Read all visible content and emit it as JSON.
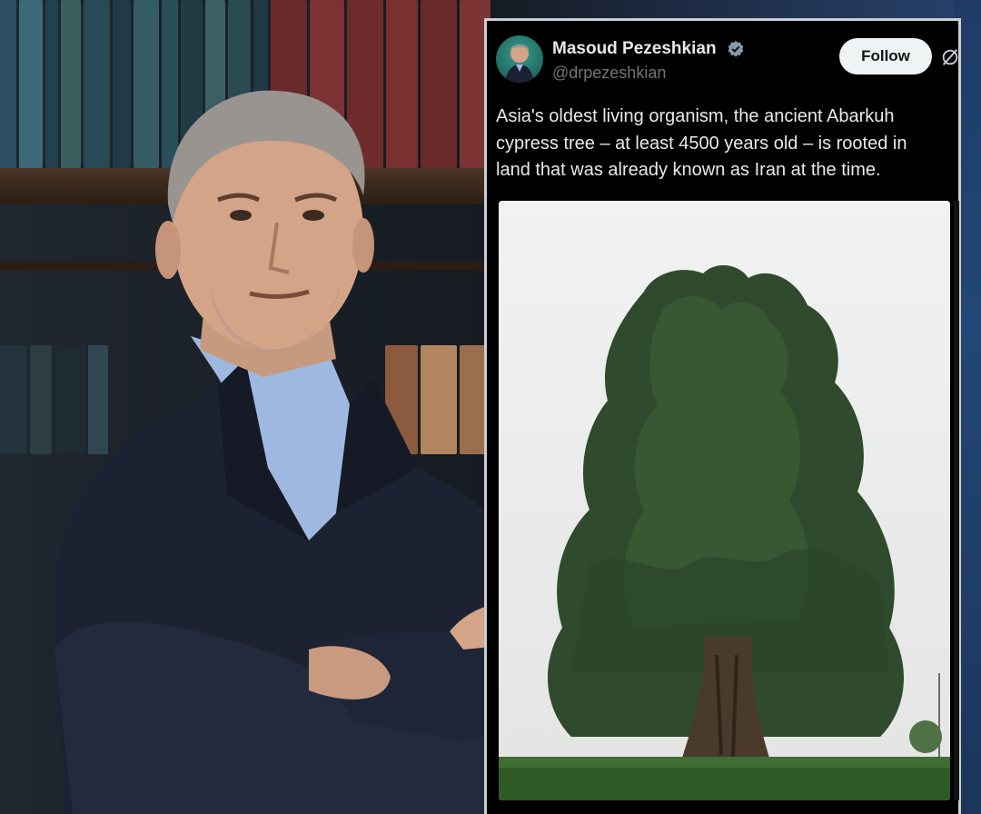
{
  "tweet": {
    "author_name": "Masoud Pezeshkian",
    "handle": "@drpezeshkian",
    "follow_label": "Follow",
    "text_lines": [
      "Asia's oldest living organism, the ancient Abarkuh",
      "cypress tree – at least 4500 years old – is rooted in",
      "land that was already known as Iran at the time."
    ],
    "verified_icon": "verified-badge-icon",
    "more_icon": "grok-icon"
  },
  "colors": {
    "card_bg": "#000000",
    "card_border": "#c9cdd3",
    "text_primary": "#e7e9ea",
    "text_secondary": "#71767b",
    "verified": "#829aab",
    "follow_bg": "#eff3f4"
  }
}
